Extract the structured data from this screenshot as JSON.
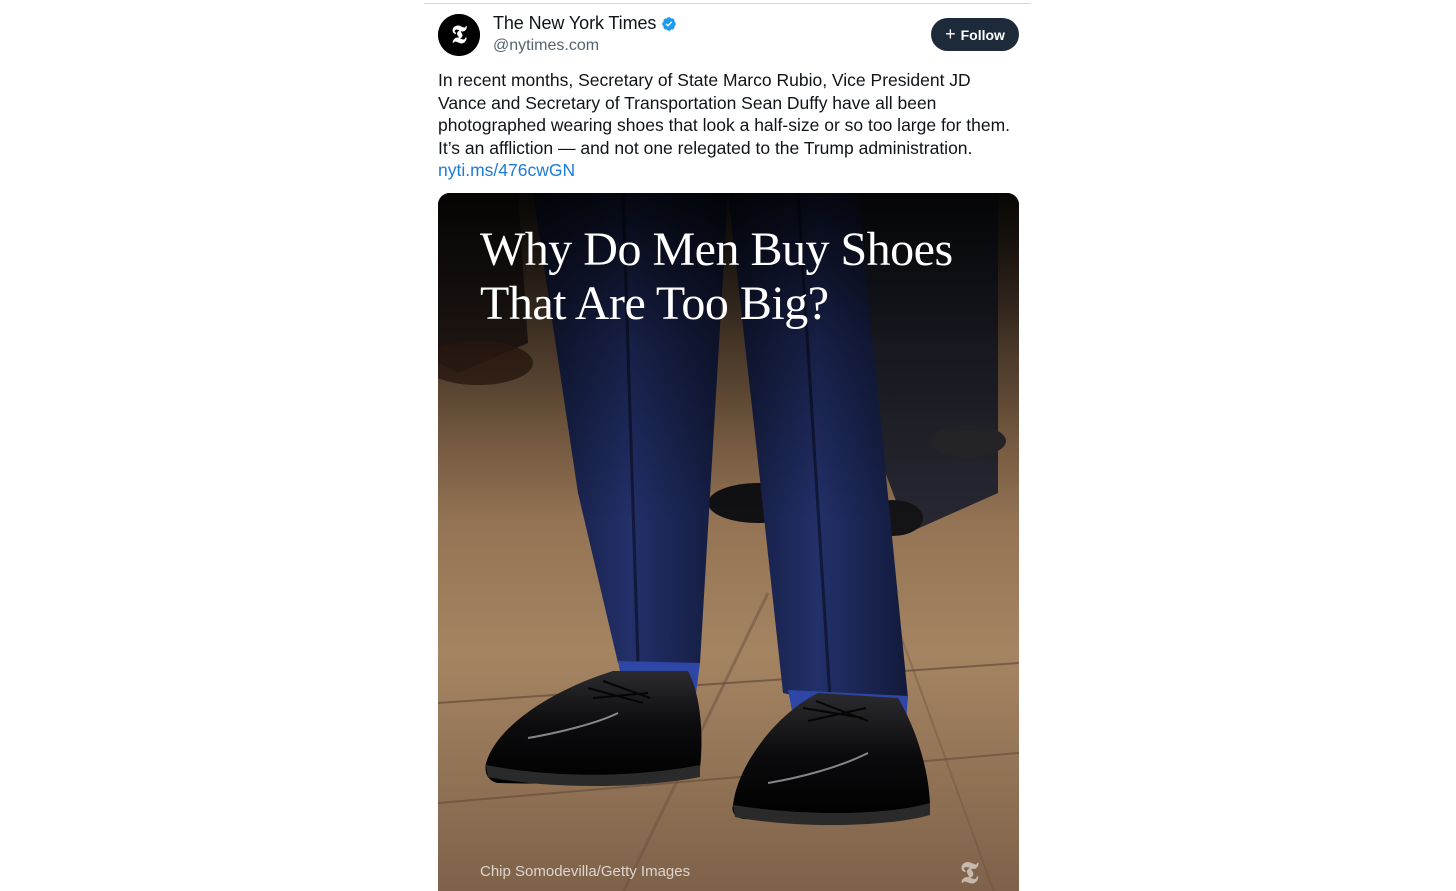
{
  "author": {
    "avatar_glyph": "𝕿",
    "name": "The New York Times",
    "handle": "@nytimes.com",
    "verified": true
  },
  "follow": {
    "icon": "plus-icon",
    "label": "Follow"
  },
  "post": {
    "text": "In recent months, Secretary of State Marco Rubio, Vice President JD Vance and Secretary of Transportation Sean Duffy have all been photographed wearing shoes that look a half-size or so too large for them. It’s an affliction — and not one relegated to the Trump administration. ",
    "link": "nyti.ms/476cwGN"
  },
  "media": {
    "headline_line1": "Why Do Men Buy Shoes",
    "headline_line2": "That Are Too Big?",
    "credit": "Chip Somodevilla/Getty Images",
    "watermark": "𝕿"
  },
  "colors": {
    "link": "#1d7bd7",
    "follow_bg": "#1d2a3a",
    "verified": "#1d9bf0"
  }
}
